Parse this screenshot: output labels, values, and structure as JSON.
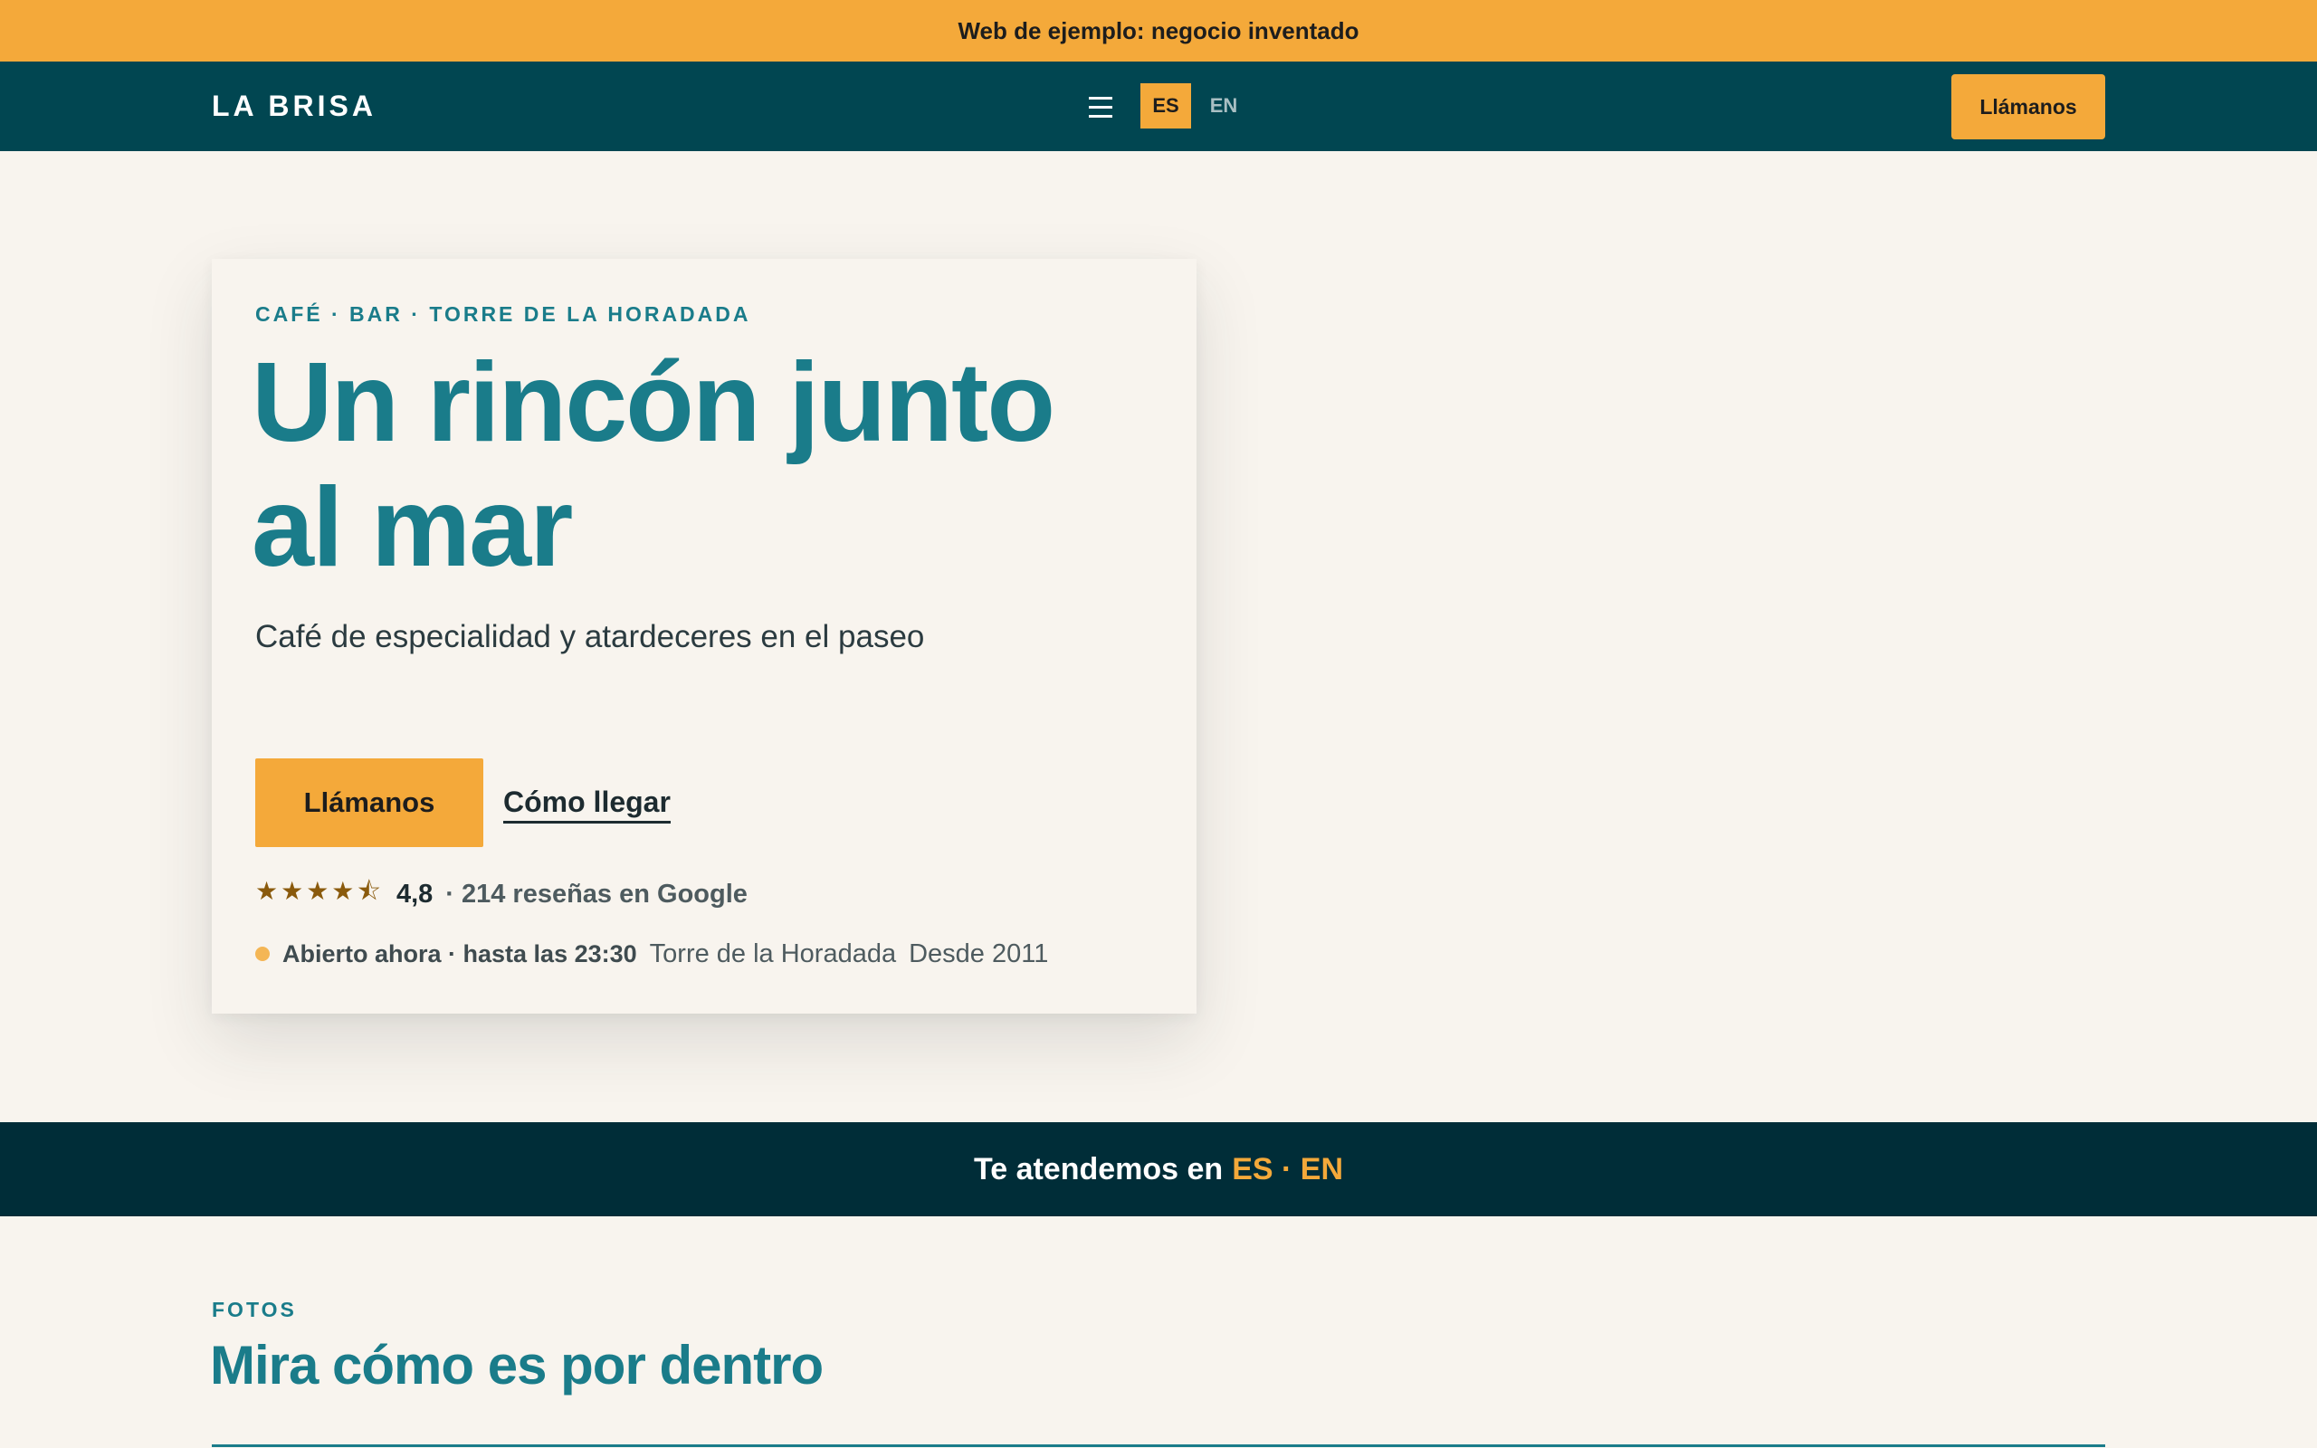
{
  "demo_banner": {
    "text": "Web de ejemplo: negocio inventado"
  },
  "header": {
    "brand": "LA BRISA",
    "menu_icon": "hamburger-icon",
    "languages": {
      "active": "ES",
      "inactive": "EN"
    },
    "cta_label": "Llámanos"
  },
  "hero": {
    "eyebrow": "CAFÉ · BAR · TORRE DE LA HORADADA",
    "title": "Un rincón junto al mar",
    "subtitle": "Café de especialidad y atardeceres en el paseo",
    "primary_button": "Llámanos",
    "secondary_link": "Cómo llegar",
    "rating": {
      "stars_display": "★★★★⯪",
      "stars_value": 4.8,
      "stars_max": 5,
      "score": "4,8",
      "reviews": "· 214 reseñas en Google"
    },
    "status": {
      "open_text": "Abierto ahora · hasta las 23:30",
      "place": "Torre de la Horadada",
      "since": "Desde 2011"
    }
  },
  "language_strip": {
    "prefix": "Te atendemos en",
    "languages": "ES · EN"
  },
  "photos": {
    "eyebrow": "FOTOS",
    "title": "Mira cómo es por dentro"
  },
  "colors": {
    "accent": "#f4a93a",
    "header_bg": "#014651",
    "teal": "#1a7c8a",
    "dark_strip": "#002d38",
    "page_bg": "#f8f4ee"
  }
}
